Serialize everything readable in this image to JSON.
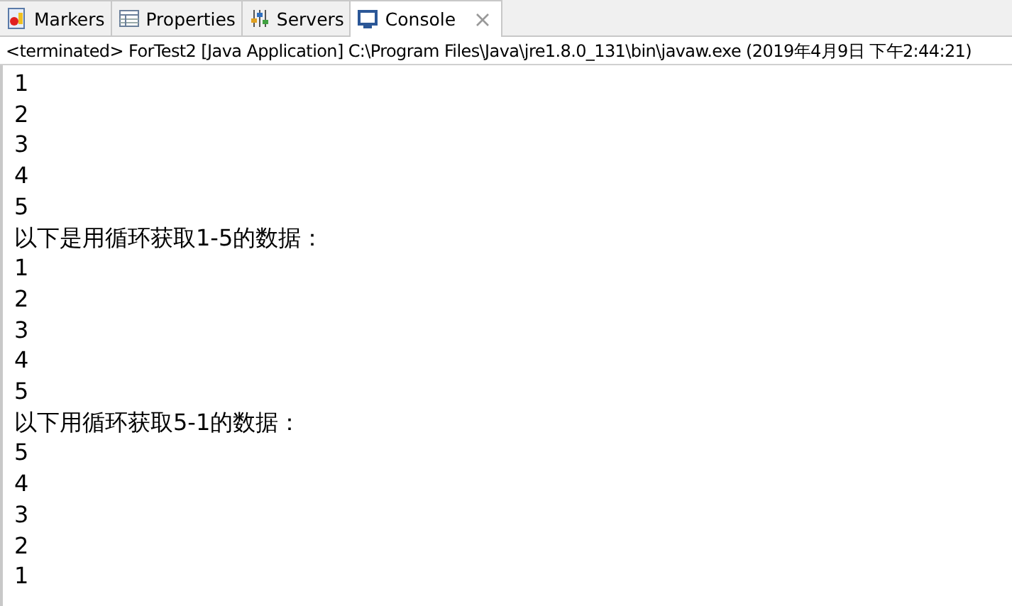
{
  "tabs": [
    {
      "label": "Markers",
      "selected": false,
      "kind": "markers"
    },
    {
      "label": "Properties",
      "selected": false,
      "kind": "properties"
    },
    {
      "label": "Servers",
      "selected": false,
      "kind": "servers"
    },
    {
      "label": "Console",
      "selected": true,
      "kind": "console"
    }
  ],
  "console": {
    "status": "<terminated> ForTest2 [Java Application] C:\\Program Files\\Java\\jre1.8.0_131\\bin\\javaw.exe (2019年4月9日 下午2:44:21)",
    "lines": [
      "1",
      "2",
      "3",
      "4",
      "5",
      "以下是用循环获取1-5的数据：",
      "1",
      "2",
      "3",
      "4",
      "5",
      "以下用循环获取5-1的数据：",
      "5",
      "4",
      "3",
      "2",
      "1"
    ]
  }
}
